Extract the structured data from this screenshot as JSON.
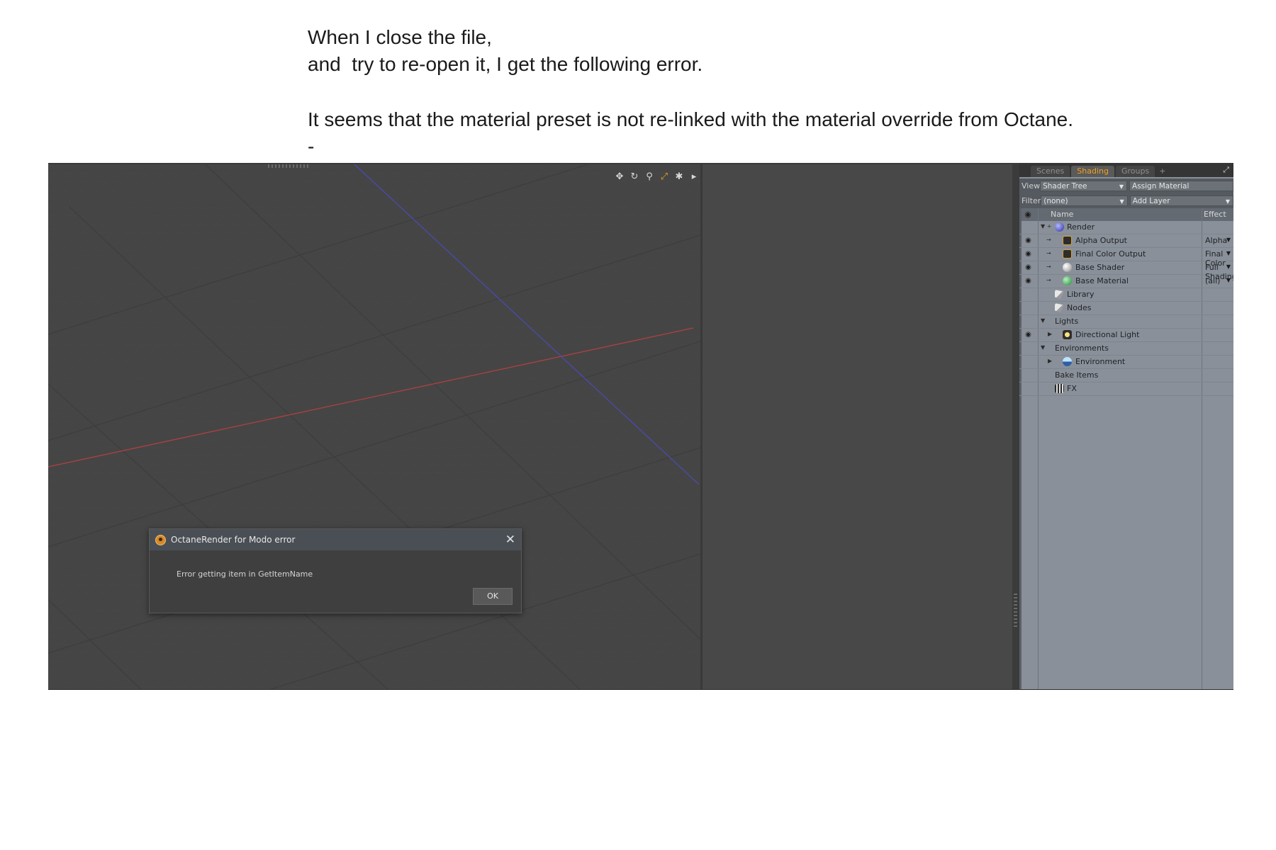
{
  "notes": {
    "line1": "When I close the file,",
    "line2": "and  try to re-open it, I get the following error.",
    "line3": "It seems that the material preset is not re-linked with the material override from Octane.",
    "line4": "-"
  },
  "viewport": {
    "tools": [
      "move-icon",
      "rotate-icon",
      "zoom-icon",
      "fit-icon",
      "gear-icon",
      "arrow-right-icon"
    ],
    "axis_colors": {
      "x": "#b04040",
      "z": "#4a4ab0"
    }
  },
  "dialog": {
    "title": "OctaneRender for Modo error",
    "message": "Error getting item in GetItemName",
    "ok_label": "OK",
    "close_glyph": "✕"
  },
  "panel": {
    "tabs": [
      "Scenes",
      "Shading",
      "Groups",
      "+"
    ],
    "active_tab": "Shading",
    "view_label": "View",
    "view_value": "Shader Tree",
    "assign_material": "Assign Material",
    "filter_label": "Filter",
    "filter_value": "(none)",
    "add_layer": "Add Layer",
    "col_name": "Name",
    "col_effect": "Effect",
    "rows": [
      {
        "label": "Render",
        "effect": ""
      },
      {
        "label": "Alpha Output",
        "effect": "Alpha"
      },
      {
        "label": "Final Color Output",
        "effect": "Final Color"
      },
      {
        "label": "Base Shader",
        "effect": "Full Shading"
      },
      {
        "label": "Base Material",
        "effect": "(all)"
      },
      {
        "label": "Library",
        "effect": ""
      },
      {
        "label": "Nodes",
        "effect": ""
      },
      {
        "label": "Lights",
        "effect": ""
      },
      {
        "label": "Directional Light",
        "effect": ""
      },
      {
        "label": "Environments",
        "effect": ""
      },
      {
        "label": "Environment",
        "effect": ""
      },
      {
        "label": "Bake Items",
        "effect": ""
      },
      {
        "label": "FX",
        "effect": ""
      }
    ]
  }
}
